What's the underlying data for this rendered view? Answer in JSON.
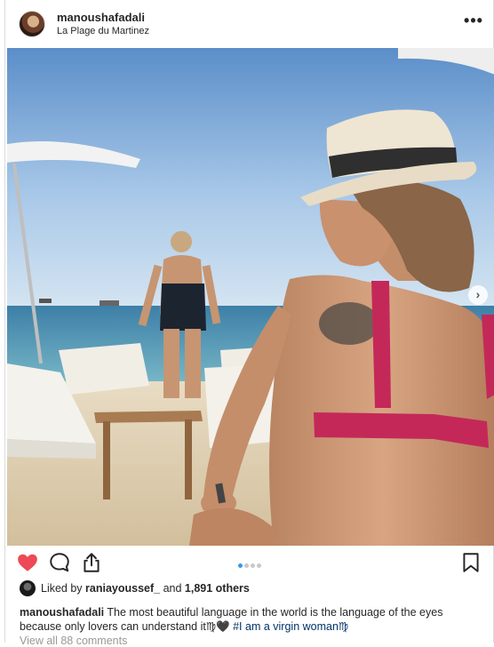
{
  "header": {
    "username": "manoushafadali",
    "location": "La Plage du Martinez",
    "more_icon": "more-horizontal-icon",
    "more_label": "•••"
  },
  "carousel": {
    "next_icon": "chevron-right-icon",
    "next_label": "›",
    "dot_count": 4,
    "active_dot": 0
  },
  "actions": {
    "like_icon": "heart-filled-icon",
    "comment_icon": "comment-bubble-icon",
    "share_icon": "share-upload-icon",
    "save_icon": "bookmark-icon",
    "liked": true
  },
  "likes": {
    "prefix": "Liked by ",
    "user": "raniayoussef_",
    "middle": " and ",
    "count": "1,891 others"
  },
  "caption": {
    "username": "manoushafadali",
    "text": " The most beautiful language in the world is the language of the eyes because only lovers can understand it♍🖤 ",
    "hashtag": "#I am a virgin woman♍"
  },
  "comments": {
    "view_all": "View all 88 comments"
  },
  "colors": {
    "like_red": "#ed4956",
    "link_blue": "#003569",
    "active_dot": "#3897f0",
    "muted": "#999999"
  }
}
